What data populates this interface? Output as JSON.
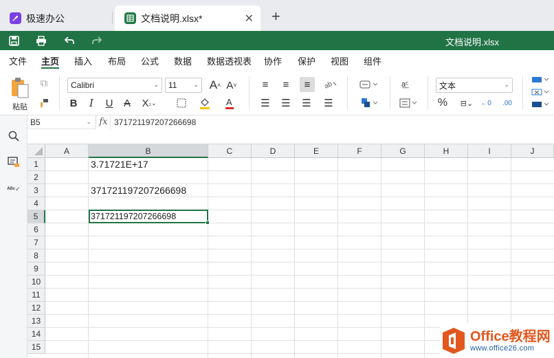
{
  "tabs": [
    {
      "label": "极速办公"
    },
    {
      "label": "文档说明.xlsx*"
    }
  ],
  "quickbar": {
    "doc_title": "文档说明.xlsx"
  },
  "menu": {
    "items": [
      "文件",
      "主页",
      "插入",
      "布局",
      "公式",
      "数据",
      "数据透视表",
      "协作",
      "保护",
      "视图",
      "组件"
    ],
    "active": "主页"
  },
  "ribbon": {
    "paste_label": "粘贴",
    "font_name": "Calibri",
    "font_size": "11",
    "number_format": "文本"
  },
  "formula_bar": {
    "name_box": "B5",
    "fx": "fx",
    "formula": "371721197207266698"
  },
  "grid": {
    "columns": [
      "A",
      "B",
      "C",
      "D",
      "E",
      "F",
      "G",
      "H",
      "I",
      "J"
    ],
    "selected_column": "B",
    "rows": [
      "1",
      "2",
      "3",
      "4",
      "5",
      "6",
      "7",
      "8",
      "9",
      "10",
      "11",
      "12",
      "13",
      "14",
      "15"
    ],
    "selected_row": "5",
    "cells": {
      "B1": "3.71721E+17",
      "B3": "371721197207266698",
      "B5": "371721197207266698"
    }
  },
  "watermark": {
    "brand": "Office教程网",
    "url": "www.office26.com"
  },
  "colors": {
    "brand_green": "#217346",
    "app_purple": "#7b3fe4",
    "watermark_orange": "#e2571e"
  }
}
